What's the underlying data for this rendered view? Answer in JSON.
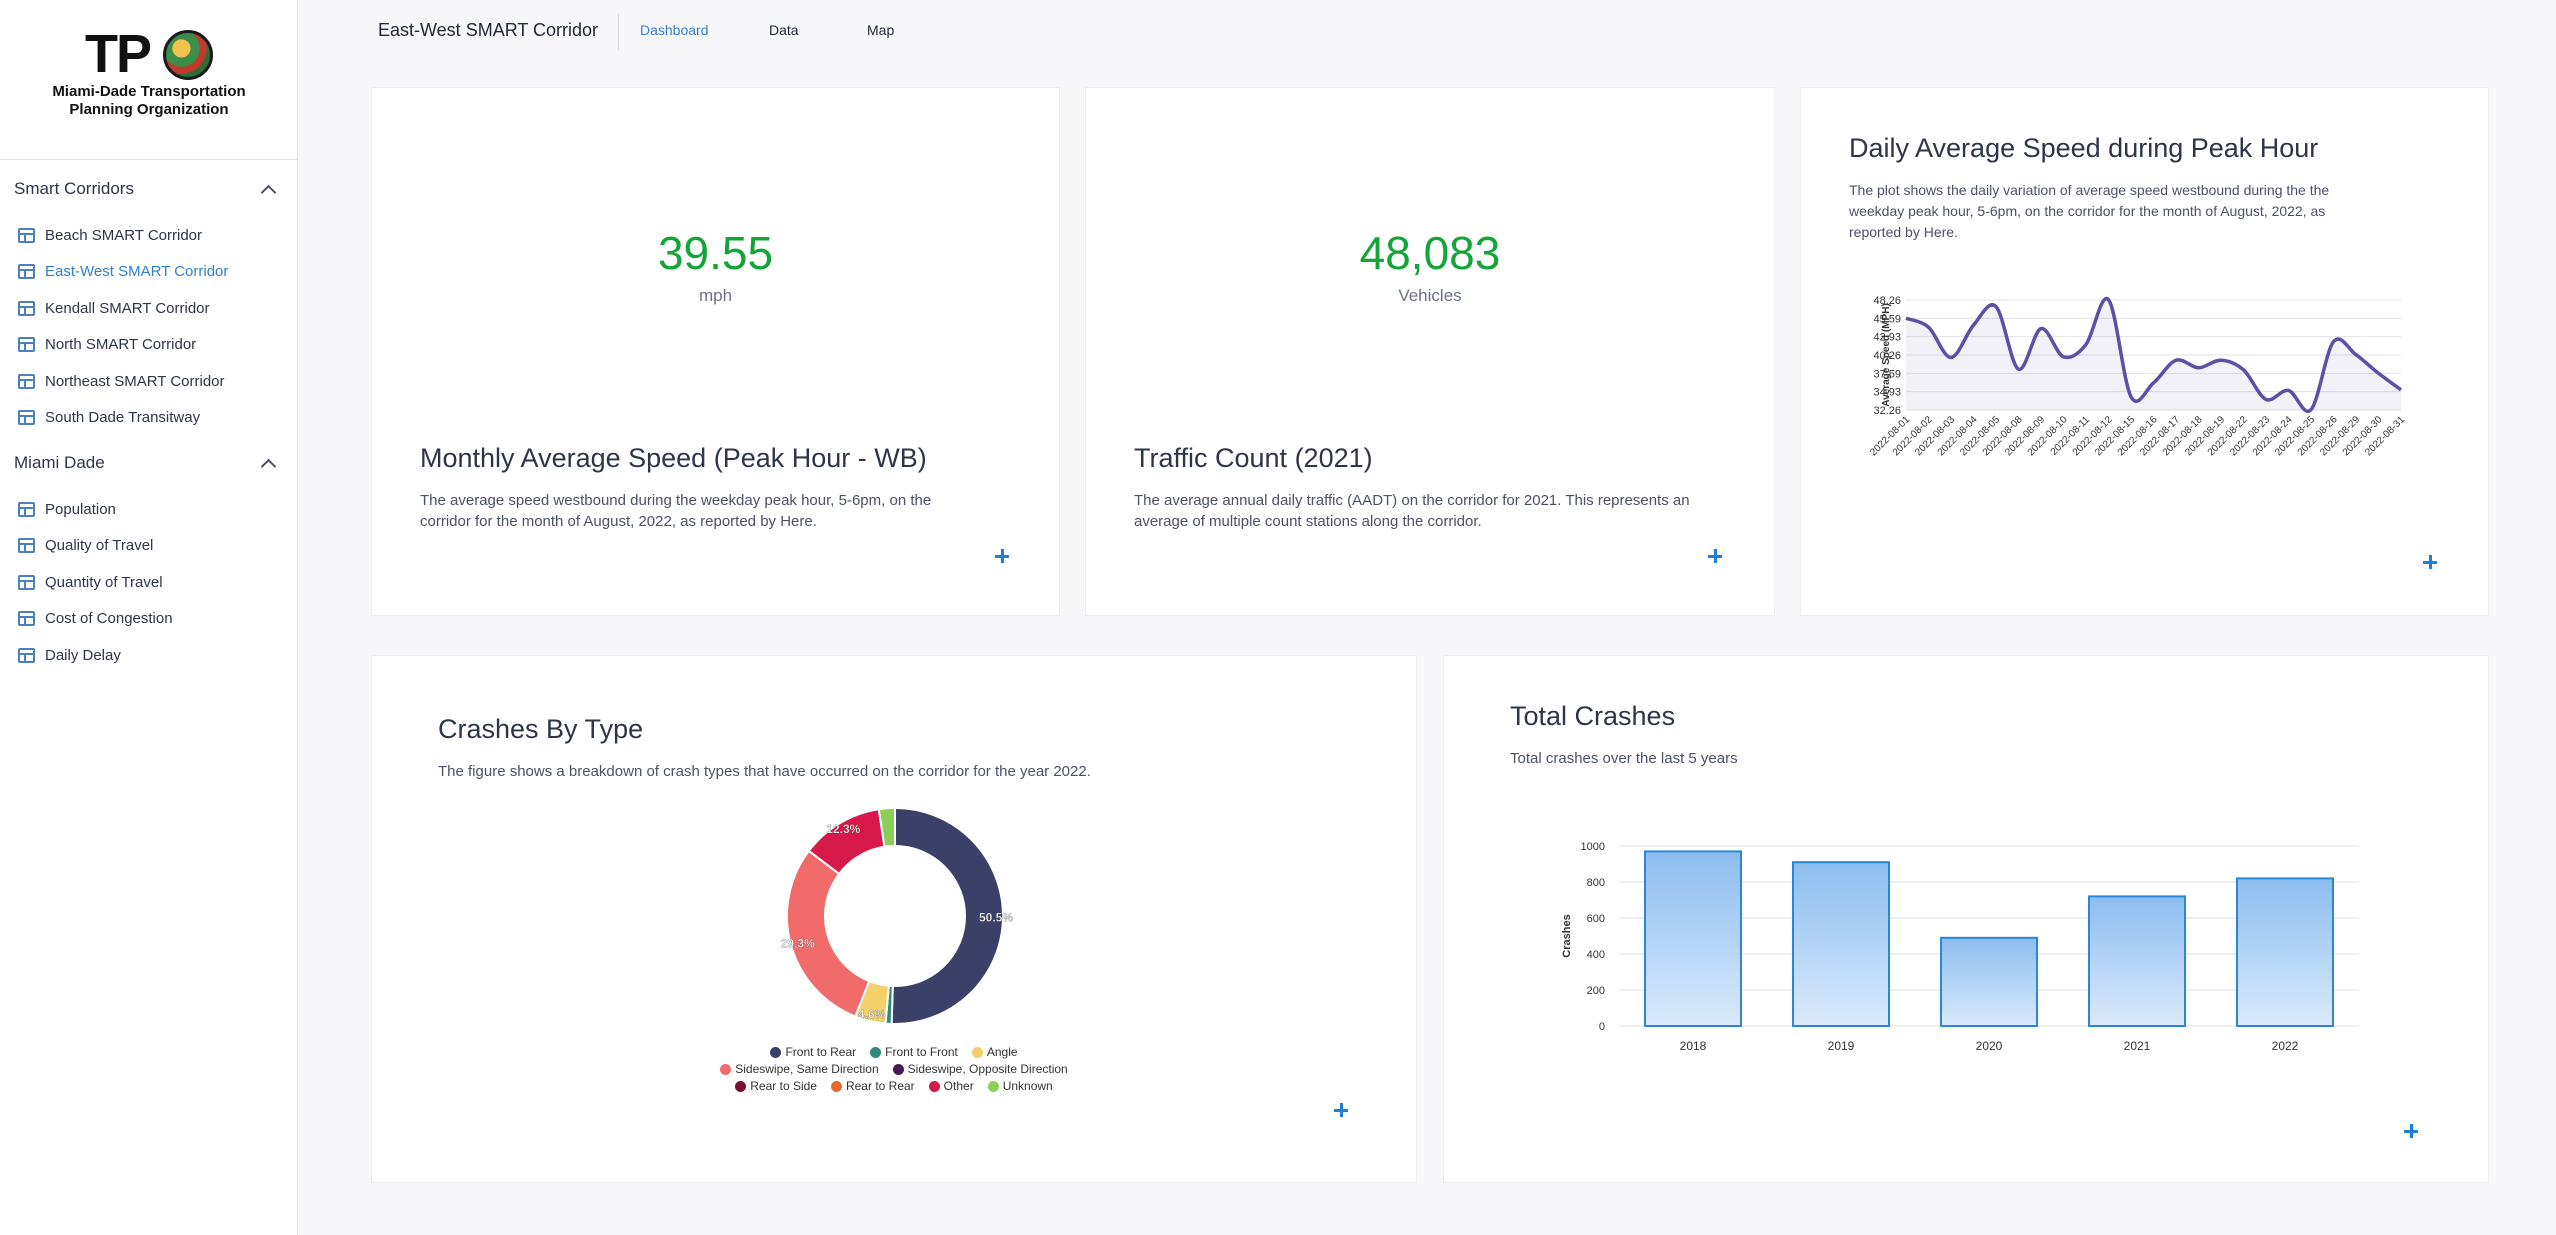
{
  "logo": {
    "mark": "TP",
    "line1": "Miami-Dade Transportation",
    "line2": "Planning Organization"
  },
  "sidebar": {
    "groups": [
      {
        "title": "Smart Corridors",
        "items": [
          {
            "label": "Beach SMART Corridor"
          },
          {
            "label": "East-West SMART Corridor"
          },
          {
            "label": "Kendall SMART Corridor"
          },
          {
            "label": "North SMART Corridor"
          },
          {
            "label": "Northeast SMART Corridor"
          },
          {
            "label": "South Dade Transitway"
          }
        ]
      },
      {
        "title": "Miami Dade",
        "items": [
          {
            "label": "Population"
          },
          {
            "label": "Quality of Travel"
          },
          {
            "label": "Quantity of Travel"
          },
          {
            "label": "Cost of Congestion"
          },
          {
            "label": "Daily Delay"
          }
        ]
      }
    ],
    "active_item": "East-West SMART Corridor"
  },
  "header": {
    "title": "East-West SMART Corridor",
    "tabs": [
      {
        "label": "Dashboard"
      },
      {
        "label": "Data"
      },
      {
        "label": "Map"
      }
    ],
    "active_tab": "Dashboard"
  },
  "cards": {
    "speed": {
      "value": "39.55",
      "unit": "mph",
      "title": "Monthly Average Speed (Peak Hour - WB)",
      "desc_line1": "The average speed westbound during the weekday peak hour, 5-6pm, on the",
      "desc_line2": "corridor for the month of August, 2022, as reported by Here."
    },
    "traffic": {
      "value": "48,083",
      "unit": "Vehicles",
      "title": "Traffic Count (2021)",
      "desc_line1": "The average annual daily traffic (AADT) on the corridor for 2021. This represents an",
      "desc_line2": "average of multiple count stations along the corridor."
    },
    "daily_speed": {
      "title": "Daily Average Speed during Peak Hour",
      "desc_line1": "The plot shows the daily variation of average speed westbound during the the",
      "desc_line2": "weekday peak hour, 5-6pm, on the corridor for the month of August, 2022, as",
      "desc_line3": "reported by Here."
    },
    "crashes_type": {
      "title": "Crashes By Type",
      "desc": "The figure shows a breakdown of crash types that have occurred on the corridor for the year 2022."
    },
    "total_crashes": {
      "title": "Total Crashes",
      "desc": "Total crashes over the last 5 years"
    }
  },
  "colors": {
    "accent": "#2f80d0",
    "kpi": "#13a538",
    "line": "#5b4fa8",
    "bar_fill": "#a9cdf2",
    "bar_stroke": "#2b86d9"
  },
  "chart_data": [
    {
      "id": "daily_speed",
      "type": "line",
      "ylabel": "Average Speed (MPH)",
      "y_ticks": [
        "48.26",
        "45.59",
        "42.93",
        "40.26",
        "37.59",
        "34.93",
        "32.26"
      ],
      "ylim": [
        32.26,
        48.26
      ],
      "x": [
        "2022-08-01",
        "2022-08-02",
        "2022-08-03",
        "2022-08-04",
        "2022-08-05",
        "2022-08-08",
        "2022-08-09",
        "2022-08-10",
        "2022-08-11",
        "2022-08-12",
        "2022-08-15",
        "2022-08-16",
        "2022-08-17",
        "2022-08-18",
        "2022-08-19",
        "2022-08-22",
        "2022-08-23",
        "2022-08-24",
        "2022-08-25",
        "2022-08-26",
        "2022-08-29",
        "2022-08-30",
        "2022-08-31"
      ],
      "values": [
        45.6,
        44.3,
        39.9,
        44.6,
        47.3,
        38.2,
        44.1,
        40.0,
        41.8,
        48.3,
        34.2,
        36.2,
        39.5,
        38.4,
        39.5,
        38.1,
        33.8,
        35.1,
        32.3,
        42.2,
        40.3,
        37.6,
        35.2
      ],
      "grid": true
    },
    {
      "id": "crashes_type",
      "type": "pie",
      "donut": true,
      "labels": [
        "Front to Rear",
        "Front to Front",
        "Angle",
        "Sideswipe, Same Direction",
        "Sideswipe, Opposite Direction",
        "Rear to Side",
        "Rear to Rear",
        "Other",
        "Unknown"
      ],
      "values": [
        50.5,
        0.9,
        4.6,
        29.3,
        0.0,
        0.0,
        0.0,
        12.3,
        2.4
      ],
      "slice_labels": [
        "50.5%",
        "",
        "4.6%",
        "29.3%",
        "",
        "",
        "",
        "12.3%",
        ""
      ],
      "colors": [
        "#3b4068",
        "#2f8a7c",
        "#f5cf6a",
        "#f26b6b",
        "#4a1757",
        "#7a1038",
        "#e86b2a",
        "#d6194a",
        "#8bcf5a"
      ],
      "legend_rows": [
        [
          0,
          1,
          2
        ],
        [
          3,
          4
        ],
        [
          5,
          6,
          7,
          8
        ]
      ],
      "legend": "bottom"
    },
    {
      "id": "total_crashes",
      "type": "bar",
      "categories": [
        "2018",
        "2019",
        "2020",
        "2021",
        "2022"
      ],
      "values": [
        970,
        910,
        490,
        720,
        820
      ],
      "ylabel": "Crashes",
      "y_ticks": [
        "0",
        "200",
        "400",
        "600",
        "800",
        "1000"
      ],
      "ylim": [
        0,
        1000
      ],
      "grid": true
    }
  ]
}
